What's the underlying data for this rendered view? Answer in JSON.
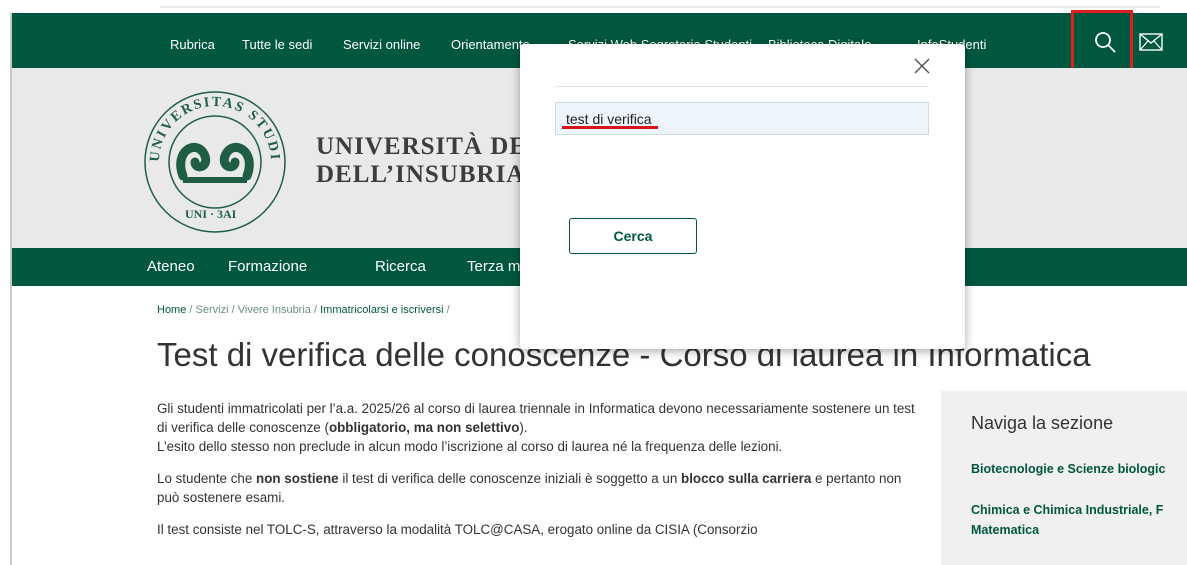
{
  "top_nav": {
    "items": [
      "Rubrica",
      "Tutte le sedi",
      "Servizi online",
      "Orientamento",
      "Servizi Web Segreteria Studenti",
      "Biblioteca Digitale",
      "InfoStudenti"
    ]
  },
  "header": {
    "university_line1": "UNIVERSITÀ DEG",
    "university_line2": "DELL’INSUBRIA",
    "logo_text": "STUDIORUM INSUBRIAE UNIVERSITAS"
  },
  "main_nav": {
    "items": [
      "Ateneo",
      "Formazione",
      "Ricerca",
      "Terza m"
    ]
  },
  "breadcrumb": {
    "home": "Home",
    "servizi": "Servizi",
    "vivere": "Vivere Insubria",
    "immatricolarsi": "Immatricolarsi e iscriversi"
  },
  "page": {
    "title": "Test di verifica delle conoscenze - Corso di laurea in Informatica",
    "p1_part1": "Gli studenti immatricolati per l’a.a. 2025/26 al corso di laurea triennale in Informatica devono necessariamente sostenere un test di verifica delle conoscenze (",
    "p1_bold": "obbligatorio, ma non selettivo",
    "p1_part2": ").",
    "p1_line2": "L’esito dello stesso non preclude in alcun modo l’iscrizione al corso di laurea né la frequenza delle lezioni.",
    "p2_part1": "Lo studente che ",
    "p2_bold1": "non sostiene",
    "p2_part2": " il test di verifica delle conoscenze iniziali è soggetto a un ",
    "p2_bold2": "blocco sulla carriera",
    "p2_part3": " e pertanto non può sostenere esami.",
    "p3": "Il test consiste nel TOLC-S, attraverso la modalità TOLC@CASA, erogato online da CISIA (Consorzio"
  },
  "sidebar": {
    "title": "Naviga la sezione",
    "links": [
      "Biotecnologie e Scienze biologic",
      "Chimica e Chimica Industriale, F",
      "Matematica"
    ]
  },
  "modal": {
    "search_value": "test di verifica",
    "button_label": "Cerca"
  },
  "colors": {
    "brand_green": "#00573f",
    "header_gray": "#e9e9e9",
    "highlight_red": "#e01e1e",
    "sidebar_bg": "#f0f0f0"
  },
  "icons": [
    "search-icon",
    "mail-icon",
    "close-icon",
    "university-logo"
  ]
}
